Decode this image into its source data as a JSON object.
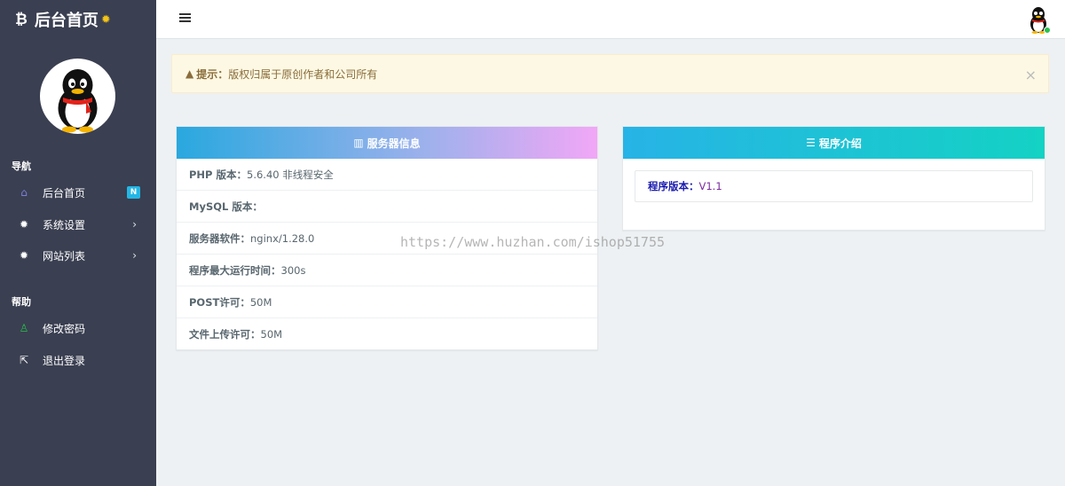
{
  "brand": {
    "icon": "bitcoin-icon",
    "title": "后台首页",
    "badge_icon": "gear-icon"
  },
  "sidebar": {
    "nav_header": "导航",
    "help_header": "帮助",
    "items": [
      {
        "label": "后台首页",
        "icon": "home-icon",
        "badge": "N"
      },
      {
        "label": "系统设置",
        "icon": "gear-icon",
        "chevron": "›"
      },
      {
        "label": "网站列表",
        "icon": "gear-icon",
        "chevron": "›"
      },
      {
        "label": "修改密码",
        "icon": "user-icon"
      },
      {
        "label": "退出登录",
        "icon": "logout-icon"
      }
    ]
  },
  "alert": {
    "prefix": "提示：",
    "text": "版权归属于原创作者和公司所有",
    "close": "×"
  },
  "server_panel": {
    "title": "服务器信息",
    "rows": [
      {
        "label": "PHP 版本：",
        "value": "5.6.40 非线程安全"
      },
      {
        "label": "MySQL 版本：",
        "value": ""
      },
      {
        "label": "服务器软件：",
        "value": "nginx/1.28.0"
      },
      {
        "label": "程序最大运行时间：",
        "value": "300s"
      },
      {
        "label": "POST许可：",
        "value": "50M"
      },
      {
        "label": "文件上传许可：",
        "value": "50M"
      }
    ]
  },
  "program_panel": {
    "title": "程序介绍",
    "version_label": "程序版本：",
    "version_value": "V1.1"
  },
  "watermark": "https://www.huzhan.com/ishop51755",
  "colors": {
    "sidebar": "#3a3f51",
    "accent": "#23b7e5",
    "alert_bg": "#fcf8e3"
  }
}
